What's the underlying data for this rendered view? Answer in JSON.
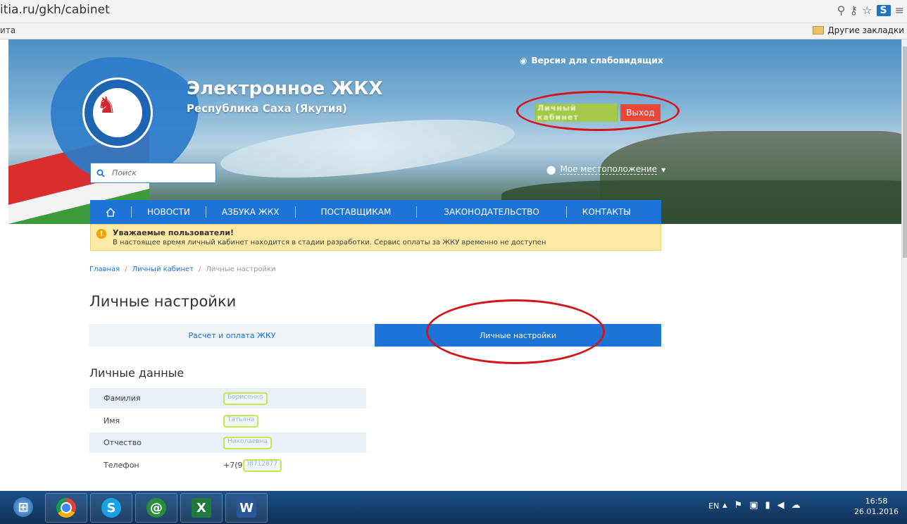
{
  "browser": {
    "url": "itia.ru/gkh/cabinet",
    "bookmarks_left": "ита",
    "bookmarks_right": "Другие закладки"
  },
  "header": {
    "site_title": "Электронное ЖКХ",
    "site_subtitle": "Республика Саха (Якутия)",
    "visually_impaired_label": "Версия для слабовидящих",
    "login_label": "Личный кабинет",
    "logout_label": "Выход",
    "search_placeholder": "Поиск",
    "location_label": "Мое местоположение"
  },
  "nav": {
    "items": [
      "НОВОСТИ",
      "АЗБУКА ЖКХ",
      "ПОСТАВЩИКАМ",
      "ЗАКОНОДАТЕЛЬСТВО",
      "КОНТАКТЫ"
    ]
  },
  "notice": {
    "title": "Уважаемые пользователи!",
    "text": "В настоящее время личный кабинет находится в стадии разработки. Сервис оплаты за ЖКУ временно не доступен"
  },
  "breadcrumb": {
    "home": "Главная",
    "cabinet": "Личный кабинет",
    "current": "Личные настройки",
    "separator": "/"
  },
  "page_title": "Личные настройки",
  "tabs": {
    "payment": "Расчет и оплата ЖКУ",
    "settings": "Личные настройки"
  },
  "personal_data": {
    "title": "Личные данные",
    "rows": [
      {
        "label": "Фамилия",
        "value": "Борисенко"
      },
      {
        "label": "Имя",
        "value": "Татьяна"
      },
      {
        "label": "Отчество",
        "value": "Николаевна"
      },
      {
        "label": "Телефон",
        "prefix": "+7(9",
        "value": ")8712877"
      }
    ]
  },
  "taskbar": {
    "language": "EN",
    "time": "16:58",
    "date": "26.01.2016"
  },
  "colors": {
    "nav_blue": "#1e73d6",
    "login_green": "#29a329",
    "logout_red": "#e8473a",
    "notice_yellow": "#fbe9a4",
    "annotation_red": "#d4141a"
  }
}
